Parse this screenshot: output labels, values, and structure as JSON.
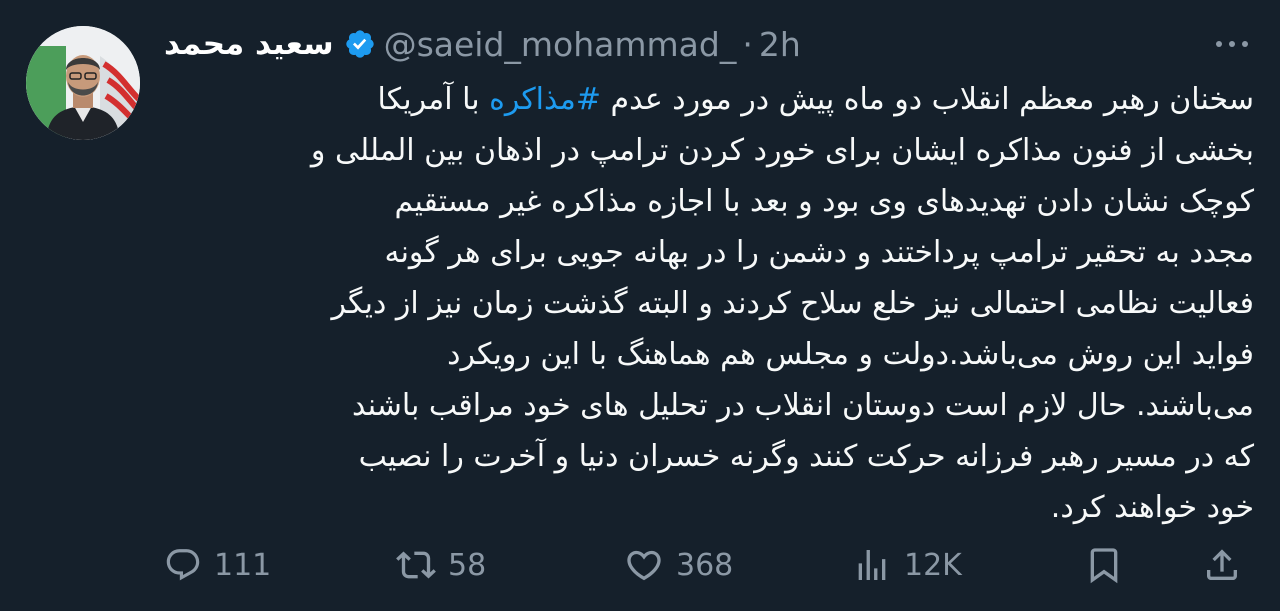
{
  "author": {
    "display_name": "سعید محمد",
    "handle": "@saeid_mohammad_",
    "separator": "·",
    "time": "2h",
    "verified": true
  },
  "tweet": {
    "lines": [
      {
        "before": "سخنان رهبر معظم انقلاب دو ماه پیش در مورد عدم ",
        "hashtag": "#مذاکره",
        "after": " با آمریکا"
      },
      {
        "before": "بخشی از فنون مذاکره ایشان برای خورد کردن ترامپ در اذهان بین المللی و"
      },
      {
        "before": "کوچک نشان دادن تهدیدهای وی بود و بعد با اجازه مذاکره غیر مستقیم"
      },
      {
        "before": "مجدد به تحقیر ترامپ پرداختند و دشمن را در بهانه جویی برای هر گونه"
      },
      {
        "before": "فعالیت نظامی احتمالی نیز خلع سلاح کردند و البته گذشت زمان نیز از دیگر"
      },
      {
        "before": "فواید این روش می‌باشد.دولت و مجلس هم هماهنگ با این رویکرد"
      },
      {
        "before": "می‌باشند. حال لازم است دوستان انقلاب در تحلیل های خود مراقب باشند"
      },
      {
        "before": "که در مسیر رهبر فرزانه حرکت کنند وگرنه خسران دنیا و آخرت را نصیب"
      },
      {
        "before": "خود خواهند کرد."
      }
    ]
  },
  "actions": {
    "replies": "111",
    "reposts": "58",
    "likes": "368",
    "views": "12K"
  },
  "icons": {
    "reply": "reply-icon",
    "repost": "repost-icon",
    "like": "heart-icon",
    "views": "views-icon",
    "bookmark": "bookmark-icon",
    "share": "share-icon",
    "more": "more-icon",
    "verified": "verified-badge-icon"
  },
  "colors": {
    "background": "#15202b",
    "text": "#f7f9f9",
    "muted": "#8b98a5",
    "accent": "#1d9bf0"
  }
}
